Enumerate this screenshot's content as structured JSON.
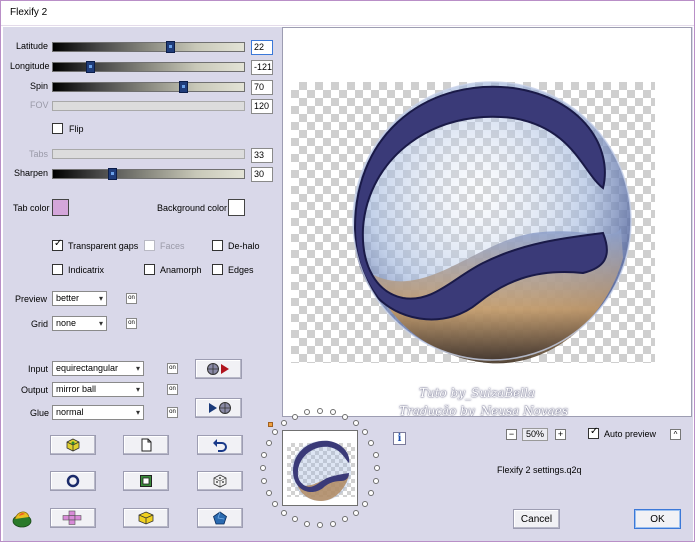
{
  "window": {
    "title": "Flexify 2"
  },
  "sliders": [
    {
      "key": "latitude",
      "label": "Latitude",
      "value": "22",
      "fraction": 0.62,
      "disabled": false,
      "active": true
    },
    {
      "key": "longitude",
      "label": "Longitude",
      "value": "-121",
      "fraction": 0.18,
      "disabled": false,
      "active": false
    },
    {
      "key": "spin",
      "label": "Spin",
      "value": "70",
      "fraction": 0.69,
      "disabled": false,
      "active": false
    },
    {
      "key": "fov",
      "label": "FOV",
      "value": "120",
      "fraction": null,
      "disabled": true,
      "active": false
    }
  ],
  "flip": {
    "label": "Flip",
    "checked": false
  },
  "tabs_slider": {
    "label": "Tabs",
    "value": "33",
    "fraction": null,
    "disabled": true
  },
  "sharpen_slider": {
    "label": "Sharpen",
    "value": "30",
    "fraction": 0.3,
    "disabled": false
  },
  "colors": {
    "tab_color_label": "Tab color",
    "tab_color": "#d4a6da",
    "background_color_label": "Background color",
    "background_color": "#ffffff"
  },
  "options": {
    "transparent_gaps": {
      "label": "Transparent gaps",
      "checked": true,
      "disabled": false
    },
    "faces": {
      "label": "Faces",
      "checked": false,
      "disabled": true
    },
    "de_halo": {
      "label": "De-halo",
      "checked": false,
      "disabled": false
    },
    "indicatrix": {
      "label": "Indicatrix",
      "checked": false,
      "disabled": false
    },
    "anamorph": {
      "label": "Anamorph",
      "checked": false,
      "disabled": false
    },
    "edges": {
      "label": "Edges",
      "checked": false,
      "disabled": false
    }
  },
  "preview_quality": {
    "label": "Preview",
    "value": "better"
  },
  "grid": {
    "label": "Grid",
    "value": "none"
  },
  "mini_button_label": "on",
  "projection": {
    "input": {
      "label": "Input",
      "value": "equirectangular"
    },
    "output": {
      "label": "Output",
      "value": "mirror ball"
    },
    "glue": {
      "label": "Glue",
      "value": "normal"
    }
  },
  "watermark": {
    "line1": "Tuto by_SuizaBella",
    "line2": "Tradução by_Neusa Novaes"
  },
  "zoom": {
    "value": "50%",
    "minus": "−",
    "plus": "+"
  },
  "auto_preview": {
    "label": "Auto preview",
    "checked": true
  },
  "collapse_label": "^",
  "info_label": "i",
  "settings_file": "Flexify 2 settings.q2q",
  "buttons": {
    "cancel": "Cancel",
    "ok": "OK"
  },
  "accent_colors": {
    "ring": "#3a3a78",
    "focus": "#3b78d8",
    "client_bg": "#d9d8e9"
  }
}
